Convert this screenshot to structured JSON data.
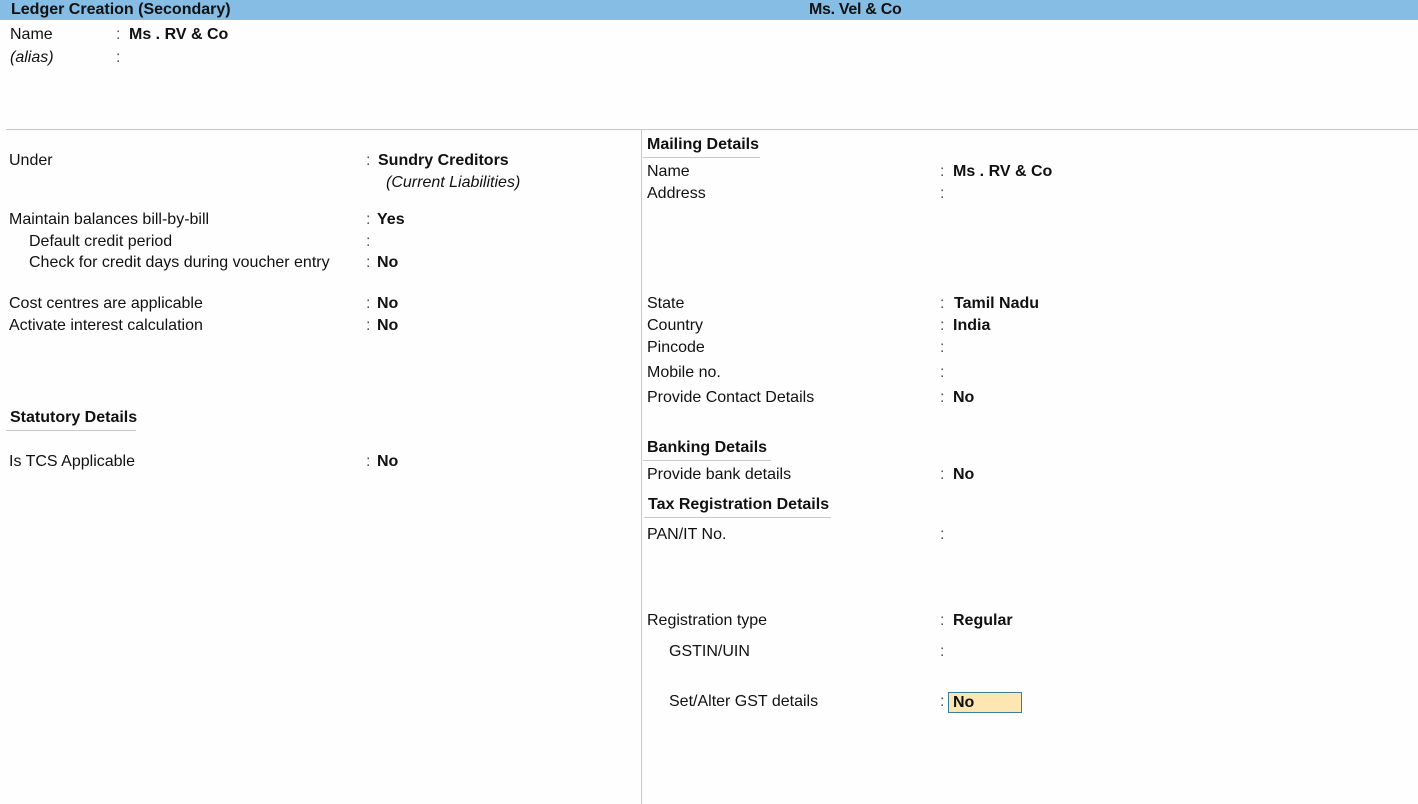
{
  "titlebar": {
    "title": "Ledger Creation (Secondary)",
    "company": "Ms. Vel  & Co"
  },
  "header": {
    "name_label": "Name",
    "name_value": "Ms . RV & Co",
    "alias_label": "(alias)",
    "alias_value": "",
    "colon": ":"
  },
  "left": {
    "under": {
      "label": "Under",
      "value": "Sundry Creditors",
      "sub": "(Current Liabilities)"
    },
    "bill_by_bill": {
      "label": "Maintain balances bill-by-bill",
      "value": "Yes"
    },
    "default_credit_period": {
      "label": "Default credit period",
      "value": ""
    },
    "check_credit_days": {
      "label": "Check for credit days during voucher entry",
      "value": "No"
    },
    "cost_centres": {
      "label": "Cost centres are applicable",
      "value": "No"
    },
    "interest_calc": {
      "label": "Activate interest calculation",
      "value": "No"
    },
    "statutory_heading": "Statutory Details",
    "tcs": {
      "label": "Is TCS Applicable",
      "value": "No"
    }
  },
  "right": {
    "mailing_heading": "Mailing Details",
    "mail_name": {
      "label": "Name",
      "value": "Ms . RV & Co"
    },
    "address": {
      "label": "Address",
      "value": ""
    },
    "state": {
      "label": "State",
      "value": "Tamil Nadu"
    },
    "country": {
      "label": "Country",
      "value": "India"
    },
    "pincode": {
      "label": "Pincode",
      "value": ""
    },
    "mobile": {
      "label": "Mobile no.",
      "value": ""
    },
    "contact_details": {
      "label": "Provide Contact Details",
      "value": "No"
    },
    "banking_heading": "Banking Details",
    "bank_details": {
      "label": "Provide bank details",
      "value": "No"
    },
    "tax_heading": "Tax Registration Details",
    "pan": {
      "label": "PAN/IT No.",
      "value": ""
    },
    "registration_type": {
      "label": "Registration type",
      "value": "Regular"
    },
    "gstin": {
      "label": "GSTIN/UIN",
      "value": ""
    },
    "gst_details": {
      "label": "Set/Alter GST details",
      "value": "No"
    }
  },
  "colors": {
    "titlebar_bg": "#86bde4",
    "focus_bg": "#fde6b2",
    "focus_border": "#3b7c9b"
  }
}
